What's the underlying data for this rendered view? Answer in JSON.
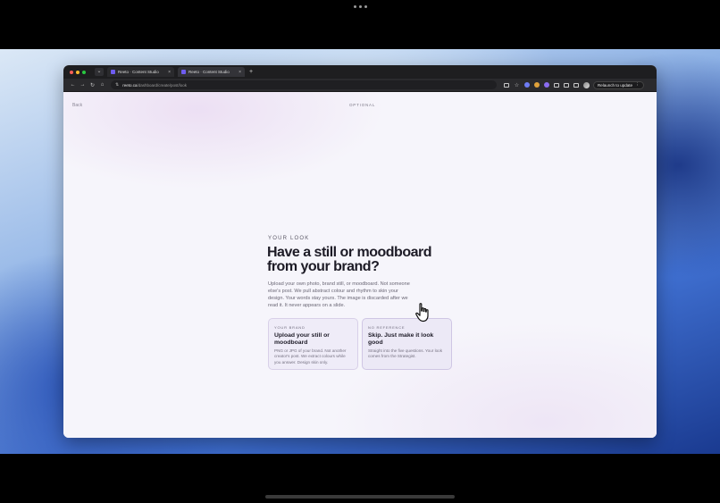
{
  "browser": {
    "tabs": [
      {
        "title": "Reeto · Content Studio",
        "active": false
      },
      {
        "title": "Reeto · Content Studio",
        "active": true
      }
    ],
    "new_tab_symbol": "+",
    "dropdown_symbol": "⌄",
    "url_host": "reeto.ca",
    "url_path": "/dashboard/create/post/look",
    "relaunch_label": "Relaunch to update",
    "menu_symbol": "⋮",
    "nav": {
      "back": "←",
      "forward": "→",
      "reload": "↻",
      "home": "⌂",
      "site_info": "⇅"
    }
  },
  "page": {
    "back_label": "Back",
    "step_label": "OPTIONAL",
    "eyebrow": "YOUR LOOK",
    "headline": "Have a still or moodboard from your brand?",
    "intro": "Upload your own photo, brand still, or moodboard. Not someone else's post. We pull abstract colour and rhythm to skin your design. Your words stay yours. The image is discarded after we read it. It never appears on a slide.",
    "options": [
      {
        "eyebrow": "YOUR BRAND",
        "title": "Upload your still or moodboard",
        "body": "PNG or JPG of your brand. Not another creator's post. We extract colours while you answer. Design skin only."
      },
      {
        "eyebrow": "NO REFERENCE",
        "title": "Skip. Just make it look good",
        "body": "Straight into the five questions. Your look comes from the Strategist."
      }
    ]
  },
  "colors": {
    "accent": "#6e5cf0",
    "headline": "#1d1b26",
    "card_bg": "#efecf8"
  },
  "icons": [
    "pointer-hand-icon",
    "lock-icon",
    "star-icon",
    "extensions-icon",
    "sidebar-icon"
  ]
}
